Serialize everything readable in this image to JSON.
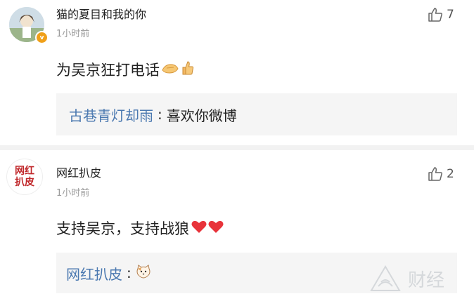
{
  "comments": [
    {
      "username": "猫的夏目和我的你",
      "verified_badge": "v",
      "time": "1小时前",
      "text": "为吴京狂打电话",
      "emojis": [
        "clap-hands-emoji",
        "thumbs-up-emoji"
      ],
      "likes": "7",
      "reply": {
        "name": "古巷青灯却雨",
        "sep": ":",
        "text": "喜欢你微博"
      }
    },
    {
      "username": "网红扒皮",
      "avatar_text": [
        "网红",
        "扒皮"
      ],
      "time": "1小时前",
      "text": "支持吴京，支持战狼",
      "emojis": [
        "red-heart-emoji",
        "red-heart-emoji"
      ],
      "likes": "2",
      "reply": {
        "name": "网红扒皮",
        "sep": ":",
        "text": "",
        "emoji": "cat-face-emoji"
      }
    }
  ],
  "watermark": {
    "text": "财经"
  },
  "colors": {
    "link": "#4a78b0",
    "heart": "#e8333a",
    "badge": "#f0a019",
    "logo": "#c0282b"
  }
}
